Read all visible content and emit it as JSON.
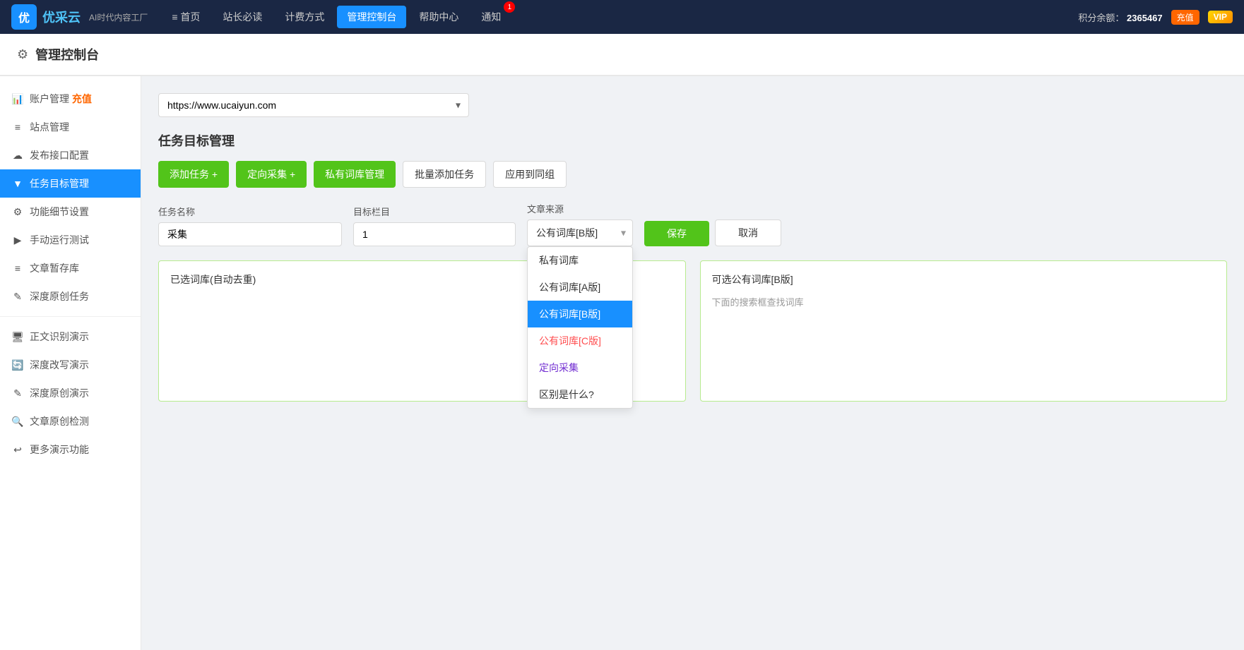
{
  "nav": {
    "logo_text": "优采云",
    "logo_sub": "AI时代内容工厂",
    "items": [
      {
        "label": "≡ 首页",
        "active": false
      },
      {
        "label": "站长必读",
        "active": false
      },
      {
        "label": "计费方式",
        "active": false
      },
      {
        "label": "管理控制台",
        "active": true
      },
      {
        "label": "帮助中心",
        "active": false
      },
      {
        "label": "通知",
        "active": false
      }
    ],
    "notification_count": "1",
    "points_label": "积分余额：",
    "points_value": "2365467",
    "recharge_label": "充值",
    "vip_label": "VIP"
  },
  "page_header": {
    "title": "管理控制台",
    "icon": "⚙"
  },
  "sidebar": {
    "items": [
      {
        "label": "账户管理",
        "icon": "📊",
        "active": false,
        "recharge": true
      },
      {
        "label": "站点管理",
        "icon": "≡",
        "active": false
      },
      {
        "label": "发布接口配置",
        "icon": "☁",
        "active": false
      },
      {
        "label": "任务目标管理",
        "icon": "▼",
        "active": true
      },
      {
        "label": "功能细节设置",
        "icon": "⚙",
        "active": false
      },
      {
        "label": "手动运行测试",
        "icon": "▶",
        "active": false
      },
      {
        "label": "文章暂存库",
        "icon": "≡",
        "active": false
      },
      {
        "label": "深度原创任务",
        "icon": "✎",
        "active": false
      },
      {
        "divider": true
      },
      {
        "label": "正文识别演示",
        "icon": "🖥",
        "active": false
      },
      {
        "label": "深度改写演示",
        "icon": "🔄",
        "active": false
      },
      {
        "label": "深度原创演示",
        "icon": "✎",
        "active": false
      },
      {
        "label": "文章原创检测",
        "icon": "🔍",
        "active": false
      },
      {
        "label": "更多演示功能",
        "icon": "↩",
        "active": false
      }
    ]
  },
  "content": {
    "url_select": {
      "value": "https://www.ucaiyun.com",
      "options": [
        "https://www.ucaiyun.com"
      ]
    },
    "section_title": "任务目标管理",
    "buttons": {
      "add_task": "添加任务 +",
      "targeted_collect": "定向采集 +",
      "private_library": "私有词库管理",
      "batch_add": "批量添加任务",
      "apply_group": "应用到同组"
    },
    "form": {
      "task_name_label": "任务名称",
      "task_name_value": "采集",
      "target_col_label": "目标栏目",
      "target_col_value": "1",
      "source_label": "文章来源",
      "source_selected": "公有词库[B版]",
      "save_label": "保存",
      "cancel_label": "取消"
    },
    "dropdown": {
      "options": [
        {
          "label": "私有词库",
          "type": "normal"
        },
        {
          "label": "公有词库[A版]",
          "type": "normal"
        },
        {
          "label": "公有词库[B版]",
          "type": "selected"
        },
        {
          "label": "公有词库[C版]",
          "type": "red"
        },
        {
          "label": "定向采集",
          "type": "purple"
        },
        {
          "label": "区别是什么?",
          "type": "normal"
        }
      ]
    },
    "left_panel": {
      "header": "已选词库(自动去重)"
    },
    "right_panel": {
      "header": "可选公有词库[B版]",
      "hint": "下面的搜索框查找词库"
    }
  }
}
